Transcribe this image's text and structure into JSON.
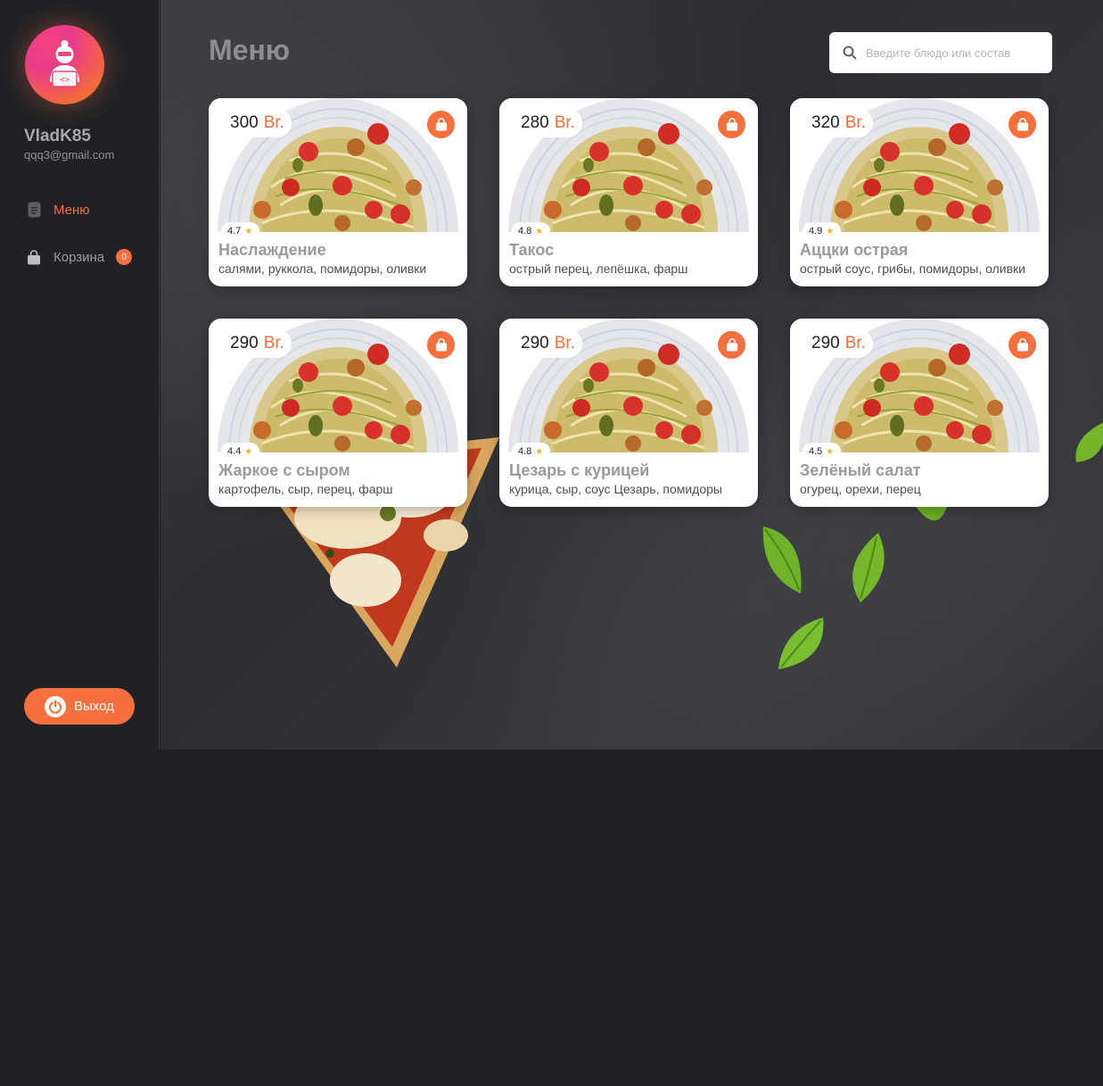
{
  "user": {
    "name": "VladK85",
    "email": "qqq3@gmail.com"
  },
  "nav": [
    {
      "label": "Меню",
      "icon": "menu-list-icon",
      "active": true
    },
    {
      "label": "Корзина",
      "icon": "shopping-bag-icon",
      "badge": "0"
    }
  ],
  "logout_label": "Выход",
  "page_title": "Меню",
  "search": {
    "placeholder": "Введите блюдо или состав",
    "value": ""
  },
  "currency": "Br.",
  "accent_color": "#f5703c",
  "dishes": [
    {
      "price": "300",
      "rating": "4.7",
      "title": "Наслаждение",
      "ingredients": "салями, руккола, помидоры, оливки"
    },
    {
      "price": "280",
      "rating": "4.8",
      "title": "Такос",
      "ingredients": "острый перец, лепёшка, фарш"
    },
    {
      "price": "320",
      "rating": "4.9",
      "title": "Аццки острая",
      "ingredients": "острый соус, грибы, помидоры, оливки"
    },
    {
      "price": "290",
      "rating": "4.4",
      "title": "Жаркое с сыром",
      "ingredients": "картофель, сыр, перец, фарш"
    },
    {
      "price": "290",
      "rating": "4.8",
      "title": "Цезарь с курицей",
      "ingredients": "курица, сыр, соус Цезарь, помидоры"
    },
    {
      "price": "290",
      "rating": "4.5",
      "title": "Зелёный салат",
      "ingredients": "огурец, орехи, перец"
    }
  ]
}
